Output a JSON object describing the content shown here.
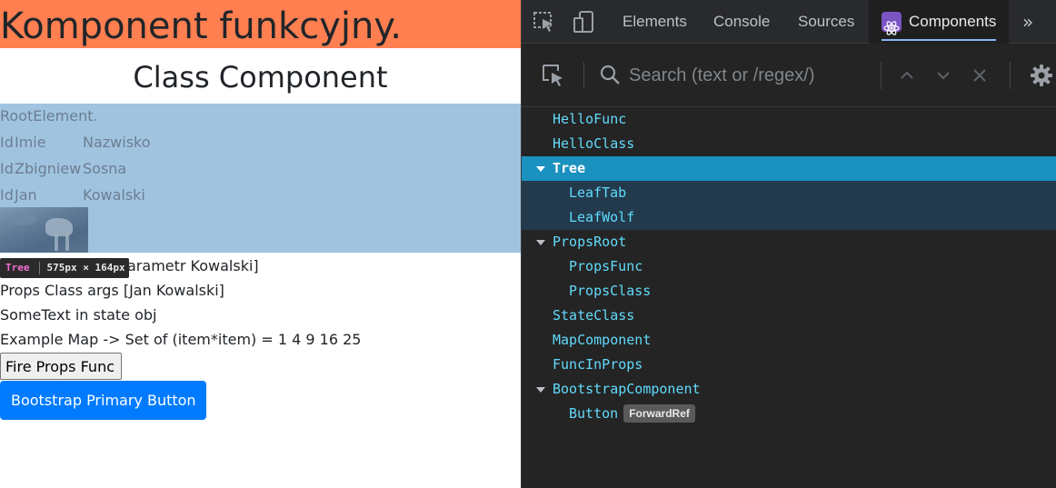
{
  "app_page": {
    "func_title": "Komponent funkcyjny.",
    "class_title": "Class Component",
    "tree": {
      "root_label": "RootElement.",
      "rows": [
        [
          "Id",
          "Imie",
          "Nazwisko"
        ],
        [
          "Id",
          "Zbigniew",
          "Sosna"
        ],
        [
          "Id",
          "Jan",
          "Kowalski"
        ]
      ],
      "highlight_color": "#a0c4e0"
    },
    "props_func_line_visible": "arametr Kowalski]",
    "props_class_line": "Props Class args [Jan Kowalski]",
    "state_line": "SomeText in state obj",
    "map_line": "Example Map -> Set of (item*item) = 1 4 9 16 25",
    "fire_button": "Fire Props Func",
    "bootstrap_button": "Bootstrap Primary Button",
    "func_title_bg": "#ff7f50",
    "bootstrap_color": "#007bff"
  },
  "highlight_tooltip": {
    "name": "Tree",
    "dimensions": "575px × 164px"
  },
  "devtools": {
    "tabs": [
      "Elements",
      "Console",
      "Sources",
      "Components"
    ],
    "active_tab": "Components",
    "icons": [
      "inspect-element-icon",
      "device-toolbar-icon",
      "react-logo-icon",
      "more-tabs-icon"
    ],
    "toolbar": {
      "search_placeholder": "Search (text or /regex/)",
      "icons": [
        "select-element-icon",
        "search-icon",
        "previous-result-icon",
        "next-result-icon",
        "clear-search-icon",
        "settings-icon"
      ]
    },
    "component_tree": [
      {
        "name": "HelloFunc",
        "depth": 0,
        "expandable": false
      },
      {
        "name": "HelloClass",
        "depth": 0,
        "expandable": false
      },
      {
        "name": "Tree",
        "depth": 0,
        "expandable": true,
        "selected": true
      },
      {
        "name": "LeafTab",
        "depth": 1,
        "expandable": false,
        "in_selected": true
      },
      {
        "name": "LeafWolf",
        "depth": 1,
        "expandable": false,
        "in_selected": true
      },
      {
        "name": "PropsRoot",
        "depth": 0,
        "expandable": true
      },
      {
        "name": "PropsFunc",
        "depth": 1,
        "expandable": false
      },
      {
        "name": "PropsClass",
        "depth": 1,
        "expandable": false
      },
      {
        "name": "StateClass",
        "depth": 0,
        "expandable": false
      },
      {
        "name": "MapComponent",
        "depth": 0,
        "expandable": false
      },
      {
        "name": "FuncInProps",
        "depth": 0,
        "expandable": false
      },
      {
        "name": "BootstrapComponent",
        "depth": 0,
        "expandable": true
      },
      {
        "name": "Button",
        "depth": 1,
        "expandable": false,
        "badge": "ForwardRef"
      }
    ],
    "accent_color": "#1a91bf",
    "component_name_color": "#61dafb"
  }
}
